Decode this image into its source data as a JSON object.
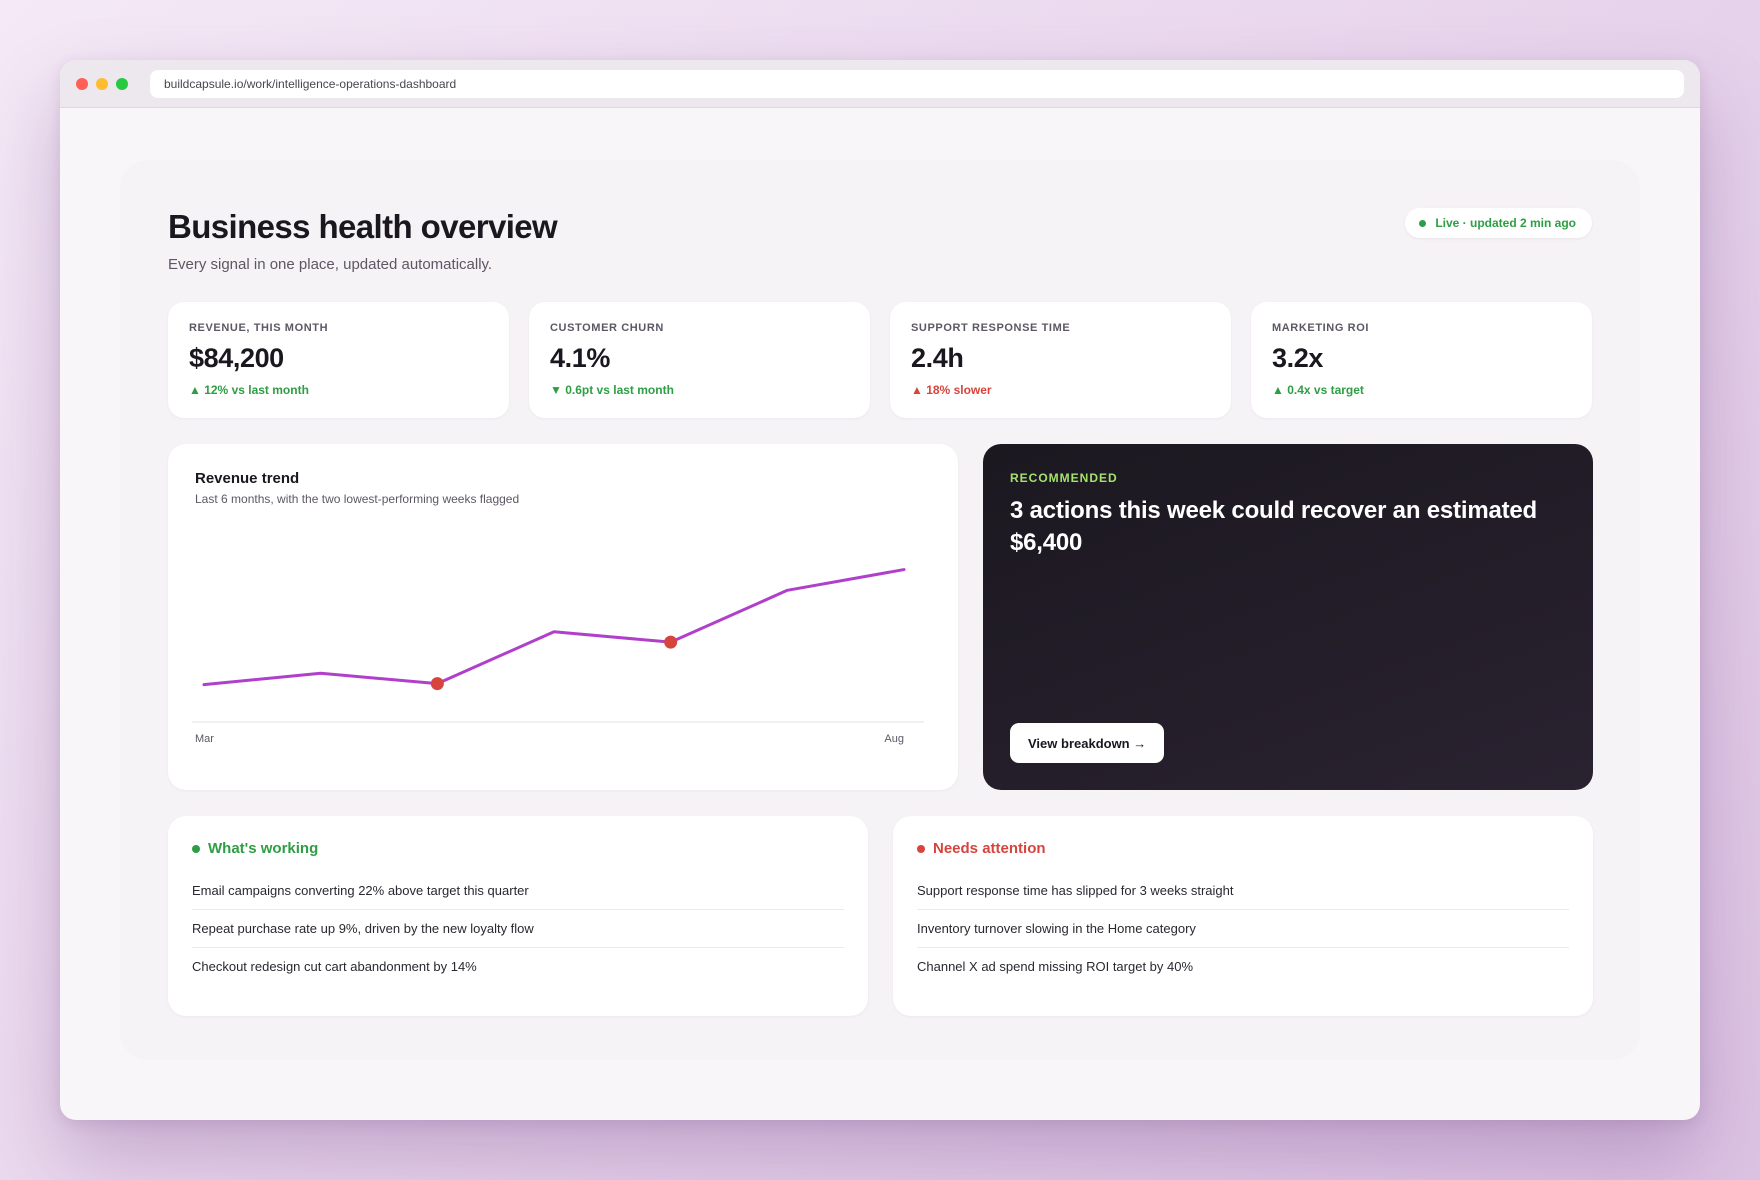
{
  "browser": {
    "url": "buildcapsule.io/work/intelligence-operations-dashboard"
  },
  "header": {
    "title": "Business health overview",
    "subtitle": "Every signal in one place, updated automatically.",
    "live_status": "Live · updated 2 min ago"
  },
  "kpis": [
    {
      "label": "REVENUE, THIS MONTH",
      "value": "$84,200",
      "delta": "▲ 12% vs last month",
      "status": "good"
    },
    {
      "label": "CUSTOMER CHURN",
      "value": "4.1%",
      "delta": "▼ 0.6pt vs last month",
      "status": "good"
    },
    {
      "label": "SUPPORT RESPONSE TIME",
      "value": "2.4h",
      "delta": "▲ 18% slower",
      "status": "bad"
    },
    {
      "label": "MARKETING ROI",
      "value": "3.2x",
      "delta": "▲ 0.4x vs target",
      "status": "good"
    }
  ],
  "trend": {
    "title": "Revenue trend",
    "subtitle": "Last 6 months, with the two lowest-performing weeks flagged"
  },
  "chart_data": {
    "type": "line",
    "x_first_label": "Mar",
    "x_last_label": "Aug",
    "values": [
      9,
      20,
      10,
      60,
      50,
      100,
      120
    ],
    "flagged_indices": [
      2,
      4
    ],
    "ylim": [
      0,
      135
    ],
    "grid": false,
    "line_color": "#b03fcb",
    "flag_color": "#d6453d"
  },
  "recommendation": {
    "tag": "RECOMMENDED",
    "headline": "3 actions this week could recover an estimated $6,400",
    "button_label": "View breakdown →"
  },
  "working": {
    "title": "What's working",
    "items": [
      "Email campaigns converting 22% above target this quarter",
      "Repeat purchase rate up 9%, driven by the new loyalty flow",
      "Checkout redesign cut cart abandonment by 14%"
    ]
  },
  "attention": {
    "title": "Needs attention",
    "items": [
      "Support response time has slipped for 3 weeks straight",
      "Inventory turnover slowing in the Home category",
      "Channel X ad spend missing ROI target by 40%"
    ]
  }
}
